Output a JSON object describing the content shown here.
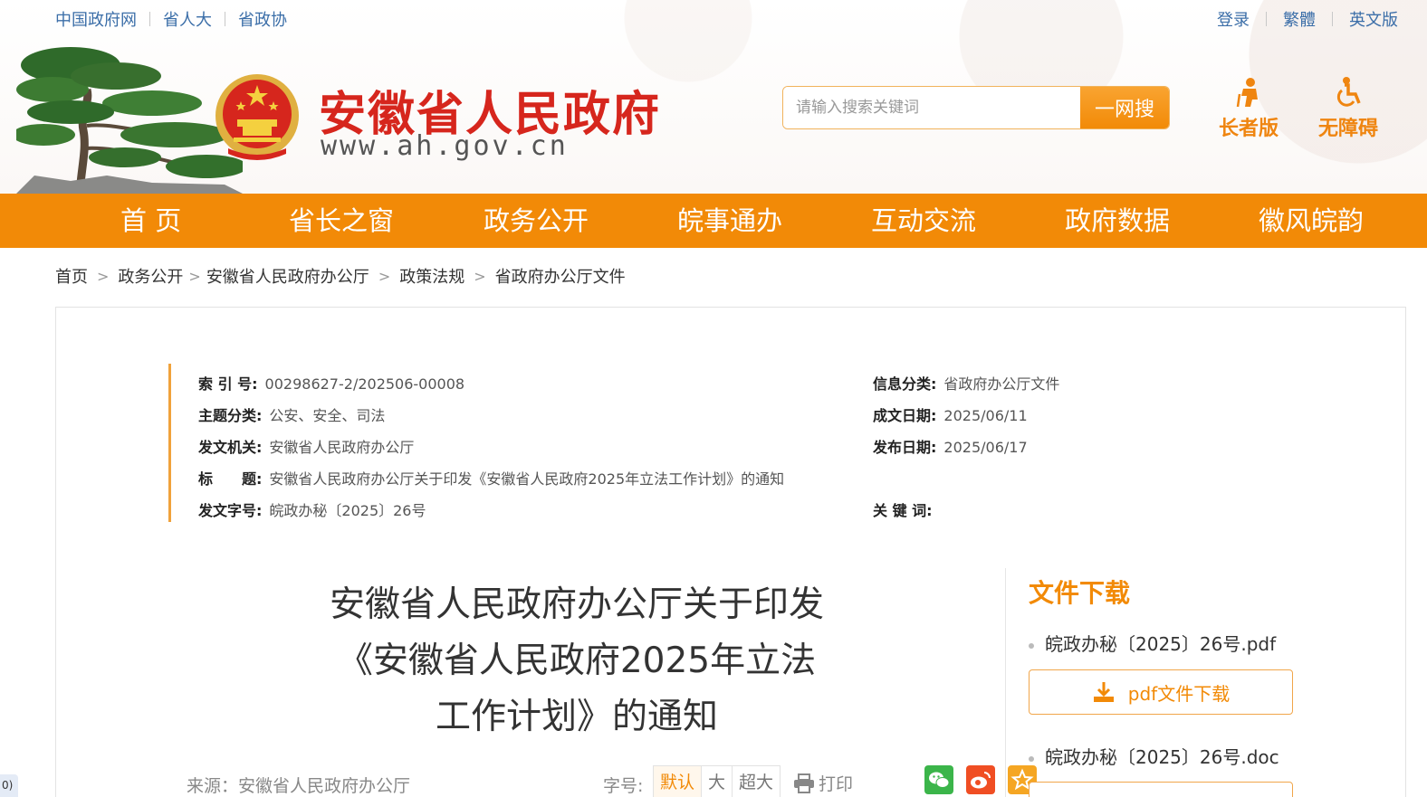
{
  "top_links": [
    "中国政府网",
    "省人大",
    "省政协"
  ],
  "top_right": [
    "登录",
    "繁體",
    "英文版"
  ],
  "site": {
    "title": "安徽省人民政府",
    "url": "www.ah.gov.cn"
  },
  "search": {
    "placeholder": "请输入搜索关键词",
    "button": "一网搜"
  },
  "modes": {
    "elder": "长者版",
    "accessible": "无障碍"
  },
  "nav": [
    "首 页",
    "省长之窗",
    "政务公开",
    "皖事通办",
    "互动交流",
    "政府数据",
    "徽风皖韵"
  ],
  "breadcrumb": [
    "首页",
    "政务公开",
    "安徽省人民政府办公厅",
    "政策法规",
    "省政府办公厅文件"
  ],
  "meta": {
    "index_label": "索 引 号:",
    "index_value": "00298627-2/202506-00008",
    "category_label": "信息分类:",
    "category_value": "省政府办公厅文件",
    "topic_label": "主题分类:",
    "topic_value": "公安、安全、司法",
    "written_date_label": "成文日期:",
    "written_date_value": "2025/06/11",
    "issuer_label": "发文机关:",
    "issuer_value": "安徽省人民政府办公厅",
    "publish_date_label": "发布日期:",
    "publish_date_value": "2025/06/17",
    "title_label": "标　　题:",
    "title_value": "安徽省人民政府办公厅关于印发《安徽省人民政府2025年立法工作计划》的通知",
    "doc_no_label": "发文字号:",
    "doc_no_value": "皖政办秘〔2025〕26号",
    "keywords_label": "关 键 词:"
  },
  "article": {
    "title_line1": "安徽省人民政府办公厅关于印发",
    "title_line2": "《安徽省人民政府2025年立法",
    "title_line3": "工作计划》的通知",
    "source": "来源：安徽省人民政府办公厅",
    "font_label": "字号:",
    "font_sizes": [
      "默认",
      "大",
      "超大"
    ],
    "print": "打印"
  },
  "download": {
    "title": "文件下载",
    "file1": "皖政办秘〔2025〕26号.pdf",
    "file1_button": "pdf文件下载",
    "file2": "皖政办秘〔2025〕26号.doc"
  },
  "left_tag": "0)",
  "colors": {
    "accent_orange": "#f28a07",
    "title_red": "#d6261d",
    "link_blue": "#3b6ea8"
  }
}
